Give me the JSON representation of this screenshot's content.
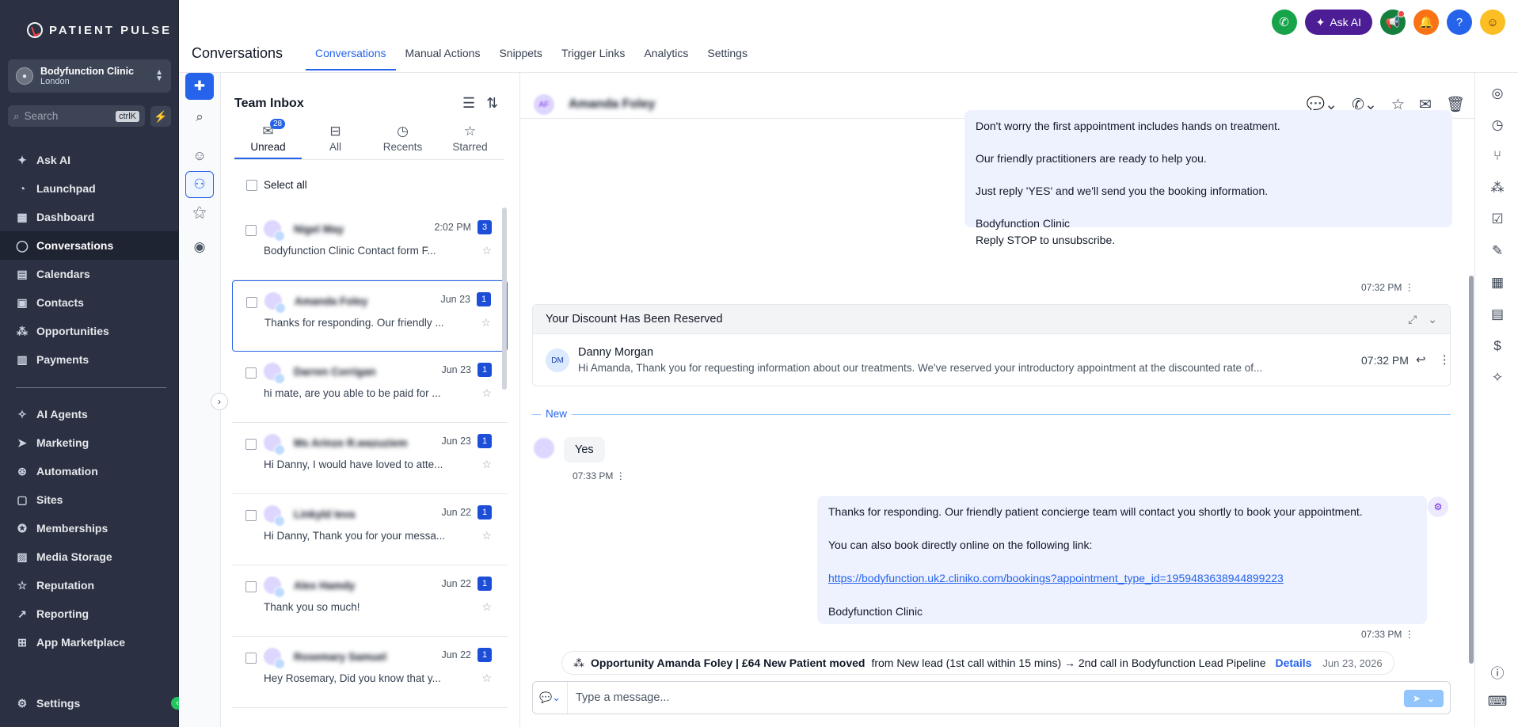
{
  "sidebar": {
    "brand": "PATIENT PULSE",
    "account": {
      "name": "Bodyfunction Clinic",
      "location": "London"
    },
    "search": {
      "placeholder": "Search",
      "shortcut": "ctrlK"
    },
    "nav": [
      {
        "label": "Ask AI",
        "icon": "sparkle-icon",
        "glyph": "✦"
      },
      {
        "label": "Launchpad",
        "icon": "rocket-icon",
        "glyph": "◔"
      },
      {
        "label": "Dashboard",
        "icon": "grid-icon",
        "glyph": "▦"
      },
      {
        "label": "Conversations",
        "icon": "chat-icon",
        "glyph": "◯",
        "active": true
      },
      {
        "label": "Calendars",
        "icon": "calendar-icon",
        "glyph": "▤"
      },
      {
        "label": "Contacts",
        "icon": "contacts-icon",
        "glyph": "▣"
      },
      {
        "label": "Opportunities",
        "icon": "opportunities-icon",
        "glyph": "⁂"
      },
      {
        "label": "Payments",
        "icon": "payments-icon",
        "glyph": "▥"
      }
    ],
    "nav2": [
      {
        "label": "AI Agents",
        "icon": "ai-agents-icon",
        "glyph": "✧"
      },
      {
        "label": "Marketing",
        "icon": "send-icon",
        "glyph": "➤"
      },
      {
        "label": "Automation",
        "icon": "automation-icon",
        "glyph": "⊛"
      },
      {
        "label": "Sites",
        "icon": "sites-icon",
        "glyph": "▢"
      },
      {
        "label": "Memberships",
        "icon": "memberships-icon",
        "glyph": "✪"
      },
      {
        "label": "Media Storage",
        "icon": "media-icon",
        "glyph": "▨"
      },
      {
        "label": "Reputation",
        "icon": "star-icon",
        "glyph": "☆"
      },
      {
        "label": "Reporting",
        "icon": "trend-icon",
        "glyph": "↗"
      },
      {
        "label": "App Marketplace",
        "icon": "apps-icon",
        "glyph": "⊞"
      }
    ],
    "settings": "Settings"
  },
  "header": {
    "title": "Conversations",
    "tabs": [
      {
        "label": "Conversations",
        "active": true
      },
      {
        "label": "Manual Actions"
      },
      {
        "label": "Snippets"
      },
      {
        "label": "Trigger Links"
      },
      {
        "label": "Analytics"
      },
      {
        "label": "Settings"
      }
    ],
    "ask_ai": "Ask AI",
    "colors": {
      "phone": "#16a34a",
      "askai": "#4c1d95",
      "announce": "#15803d",
      "bell": "#f97316",
      "help": "#2563eb"
    }
  },
  "inbox": {
    "title": "Team Inbox",
    "tabs": [
      {
        "label": "Unread",
        "badge": "28",
        "icon": "envelope-icon",
        "active": true
      },
      {
        "label": "All",
        "icon": "inbox-icon"
      },
      {
        "label": "Recents",
        "icon": "clock-icon"
      },
      {
        "label": "Starred",
        "icon": "star-icon"
      }
    ],
    "select_all": "Select all",
    "conversations": [
      {
        "name": "Nigel May",
        "time": "2:02 PM",
        "count": "3",
        "preview": "Bodyfunction Clinic Contact form F..."
      },
      {
        "name": "Amanda Foley",
        "time": "Jun 23",
        "count": "1",
        "preview": "Thanks for responding. Our friendly ...",
        "selected": true
      },
      {
        "name": "Darren Corrigan",
        "time": "Jun 23",
        "count": "1",
        "preview": "hi mate, are you able to be paid for ..."
      },
      {
        "name": "Ms Arinze R.wazuziem",
        "time": "Jun 23",
        "count": "1",
        "preview": "Hi Danny, I would have loved to atte..."
      },
      {
        "name": "Linkyld Ieva",
        "time": "Jun 22",
        "count": "1",
        "preview": "Hi Danny, Thank you for your messa..."
      },
      {
        "name": "Alex Hamdy",
        "time": "Jun 22",
        "count": "1",
        "preview": "Thank you so much!"
      },
      {
        "name": "Rosemary Samuel",
        "time": "Jun 22",
        "count": "1",
        "preview": "Hey Rosemary, Did you know that y..."
      }
    ]
  },
  "conversation": {
    "contact_name": "Amanda Foley",
    "contact_initials": "AF",
    "outgoing_1": {
      "lines": [
        "Don't worry the first appointment includes hands on treatment.",
        "Our friendly practitioners are ready to help you.",
        "Just reply 'YES' and we'll send you the booking information.",
        "Bodyfunction Clinic",
        "Reply STOP to unsubscribe."
      ],
      "time": "07:32 PM"
    },
    "email": {
      "subject": "Your Discount Has Been Reserved",
      "from": "Danny Morgan",
      "from_initials": "DM",
      "snippet": "Hi Amanda, Thank you for requesting information about our treatments. We've reserved your introductory appointment at the discounted rate of...",
      "time": "07:32 PM"
    },
    "new_label": "New",
    "incoming": {
      "text": "Yes",
      "time": "07:33 PM"
    },
    "outgoing_2": {
      "line1": "Thanks for responding. Our friendly patient concierge team will contact you shortly to book your appointment.",
      "line2": "You can also book directly online on the following link:",
      "link": "https://bodyfunction.uk2.cliniko.com/bookings?appointment_type_id=1959483638944899223",
      "line3": "Bodyfunction Clinic",
      "time": "07:33 PM"
    },
    "activity": {
      "bold": "Opportunity Amanda Foley | £64 New Patient moved",
      "rest": "from New lead (1st call within 15 mins) → 2nd call in Bodyfunction Lead Pipeline",
      "details": "Details",
      "date": "Jun 23, 2026"
    },
    "composer": {
      "placeholder": "Type a message..."
    }
  }
}
